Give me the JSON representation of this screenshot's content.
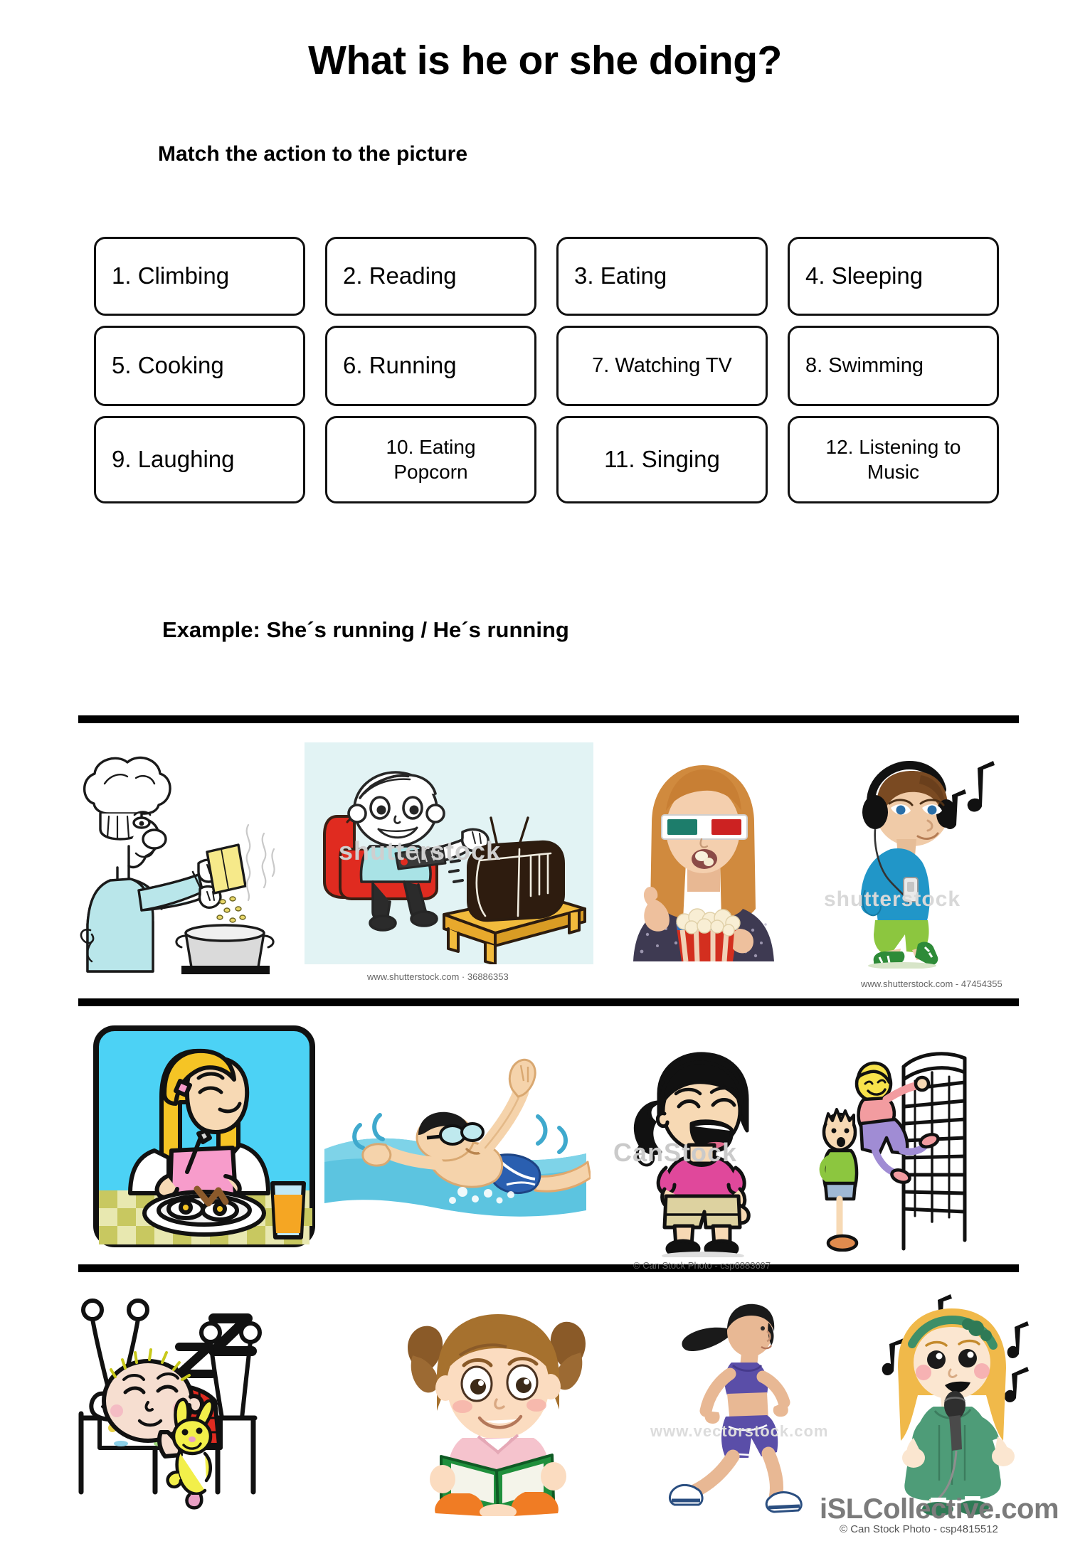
{
  "header": {
    "title": "What is he or she doing?",
    "subtitle": "Match the action to the picture"
  },
  "word_bank": {
    "rows": [
      [
        {
          "number": "1.",
          "text": "Climbing",
          "label": "1. Climbing"
        },
        {
          "number": "2.",
          "text": "Reading",
          "label": "2. Reading"
        },
        {
          "number": "3.",
          "text": "Eating",
          "label": "3. Eating"
        },
        {
          "number": "4.",
          "text": "Sleeping",
          "label": "4. Sleeping"
        }
      ],
      [
        {
          "number": "5.",
          "text": "Cooking",
          "label": "5. Cooking"
        },
        {
          "number": "6.",
          "text": "Running",
          "label": "6. Running"
        },
        {
          "number": "7.",
          "text": "Watching TV",
          "label": "7. Watching TV"
        },
        {
          "number": "8.",
          "text": "Swimming",
          "label": "8. Swimming"
        }
      ],
      [
        {
          "number": "9.",
          "text": "Laughing",
          "label": "9. Laughing"
        },
        {
          "number": "10.",
          "text": "Eating Popcorn",
          "label": "10. Eating\nPopcorn"
        },
        {
          "number": "11.",
          "text": "Singing",
          "label": "11. Singing"
        },
        {
          "number": "12.",
          "text": "Listening to Music",
          "label": "12. Listening to\nMusic"
        }
      ]
    ]
  },
  "example": {
    "text": "Example: She´s running / He´s running"
  },
  "pictures": {
    "row1": [
      {
        "name": "chef-cooking",
        "alt": "Chef pouring ingredients into a pot"
      },
      {
        "name": "boy-watching-tv",
        "alt": "Boy in red armchair with remote watching TV"
      },
      {
        "name": "girl-eating-popcorn",
        "alt": "Girl with 3D glasses eating popcorn"
      },
      {
        "name": "boy-listening-music",
        "alt": "Boy with headphones listening to music"
      }
    ],
    "row2": [
      {
        "name": "girl-eating",
        "alt": "Girl eating eggs at a table with orange juice"
      },
      {
        "name": "boy-swimming",
        "alt": "Boy swimming in blue water"
      },
      {
        "name": "girl-laughing",
        "alt": "Girl with ponytail laughing"
      },
      {
        "name": "kids-climbing",
        "alt": "Child climbing a ladder frame"
      }
    ],
    "row3": [
      {
        "name": "baby-sleeping",
        "alt": "Baby sleeping in bed with zzz and bunny toy"
      },
      {
        "name": "girl-reading",
        "alt": "Girl with pigtails reading a green book"
      },
      {
        "name": "woman-running",
        "alt": "Woman jogging in purple sports outfit"
      },
      {
        "name": "girl-singing",
        "alt": "Girl in green dress singing into a microphone"
      }
    ]
  },
  "watermarks": {
    "shutterstock_tv": "www.shutterstock.com · 36886353",
    "shutterstock_music": "www.shutterstock.com - 47454355",
    "canstock_laughing": "© Can Stock Photo - csp6883697",
    "canstock_singing": "© Can Stock Photo - csp4815512",
    "islcollective": "iSLCollective.com",
    "ghost_shutterstock": "shutterstock",
    "ghost_canstock": "CanStock",
    "ghost_vectorstock": "www.vectorstock.com"
  },
  "colors": {
    "ink": "#000000",
    "box_border": "#111111",
    "tv_panel_bg": "#e2f3f4",
    "eating_panel_bg": "#4cd2f5",
    "water_blue": "#5cc4e0",
    "watermark_gray": "#7b7b7b"
  }
}
